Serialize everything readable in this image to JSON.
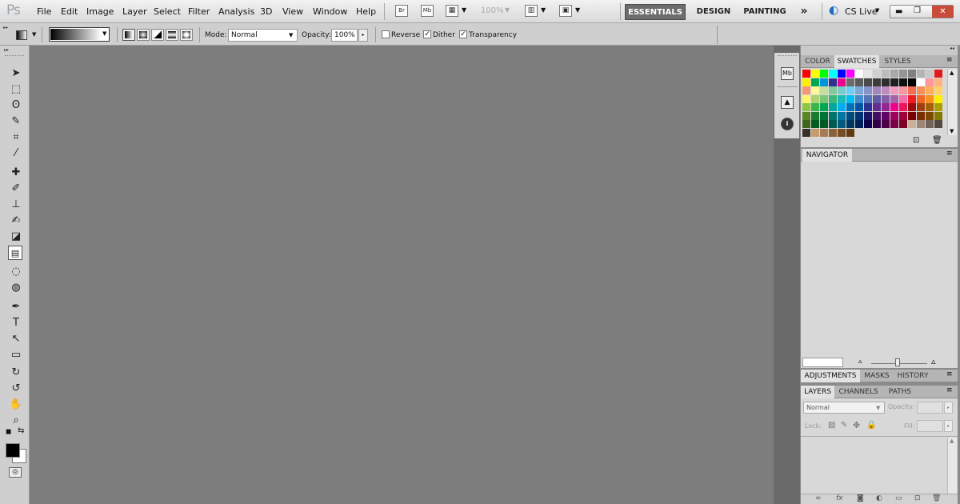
{
  "app": {
    "logo": "Ps"
  },
  "menubar": {
    "items": [
      "File",
      "Edit",
      "Image",
      "Layer",
      "Select",
      "Filter",
      "Analysis",
      "3D",
      "View",
      "Window",
      "Help"
    ],
    "bridge_icon": "Br",
    "minibridge_icon": "Mb",
    "zoom": "100%",
    "workspaces": {
      "essentials": "ESSENTIALS",
      "design": "DESIGN",
      "painting": "PAINTING",
      "more": "»"
    },
    "cslive": "CS Live"
  },
  "options": {
    "mode_label": "Mode:",
    "mode_value": "Normal",
    "opacity_label": "Opacity:",
    "opacity_value": "100%",
    "reverse_label": "Reverse",
    "dither_label": "Dither",
    "transparency_label": "Transparency",
    "check_mark": "✓"
  },
  "tools": [
    {
      "name": "move-tool-icon",
      "glyph": "➤"
    },
    {
      "name": "marquee-tool-icon",
      "glyph": "⬚"
    },
    {
      "name": "lasso-tool-icon",
      "glyph": "ʘ"
    },
    {
      "name": "quick-select-tool-icon",
      "glyph": "✎"
    },
    {
      "name": "crop-tool-icon",
      "glyph": "⌗"
    },
    {
      "name": "eyedropper-tool-icon",
      "glyph": "⁄"
    },
    {
      "name": "healing-brush-tool-icon",
      "glyph": "✚"
    },
    {
      "name": "brush-tool-icon",
      "glyph": "✐"
    },
    {
      "name": "clone-stamp-tool-icon",
      "glyph": "⊥"
    },
    {
      "name": "history-brush-tool-icon",
      "glyph": "✍"
    },
    {
      "name": "eraser-tool-icon",
      "glyph": "◪"
    },
    {
      "name": "gradient-tool-icon",
      "glyph": "▤"
    },
    {
      "name": "blur-tool-icon",
      "glyph": "◌"
    },
    {
      "name": "dodge-tool-icon",
      "glyph": "◍"
    },
    {
      "name": "pen-tool-icon",
      "glyph": "✒"
    },
    {
      "name": "type-tool-icon",
      "glyph": "T"
    },
    {
      "name": "path-selection-tool-icon",
      "glyph": "↖"
    },
    {
      "name": "shape-tool-icon",
      "glyph": "▭"
    },
    {
      "name": "3d-rotate-tool-icon",
      "glyph": "↻"
    },
    {
      "name": "3d-orbit-tool-icon",
      "glyph": "↺"
    },
    {
      "name": "hand-tool-icon",
      "glyph": "✋"
    },
    {
      "name": "zoom-tool-icon",
      "glyph": "⌕"
    }
  ],
  "colors": {
    "foreground": "#000000",
    "background": "#ffffff"
  },
  "panels": {
    "color_tab": "COLOR",
    "swatches_tab": "SWATCHES",
    "styles_tab": "STYLES",
    "navigator_tab": "NAVIGATOR",
    "adjustments_tab": "ADJUSTMENTS",
    "masks_tab": "MASKS",
    "history_tab": "HISTORY",
    "layers_tab": "LAYERS",
    "channels_tab": "CHANNELS",
    "paths_tab": "PATHS",
    "layers_mode": "Normal",
    "opacity_label": "Opacity:",
    "lock_label": "Lock:",
    "fill_label": "Fill:"
  },
  "swatches": [
    [
      "#ff0000",
      "#ffff00",
      "#00ff00",
      "#00ffff",
      "#0000ff",
      "#ff00ff",
      "#ffffff",
      "#e6e6e6",
      "#d0d0d0",
      "#bcbcbc",
      "#a8a8a8",
      "#949494",
      "#808080",
      "#b4b4b4",
      "#c8c8c8",
      "#e01919"
    ],
    [
      "#ffee00",
      "#00a651",
      "#0093dd",
      "#2e3192",
      "#ec008c",
      "#6b6b6b",
      "#5a5a5a",
      "#4a4a4a",
      "#3c3c3c",
      "#2e2e2e",
      "#1f1f1f",
      "#111111",
      "#000000",
      "#ffffff",
      "#ff9999",
      "#ffb380"
    ],
    [
      "#f7977a",
      "#fff79a",
      "#c4df9b",
      "#82ca9c",
      "#7accc8",
      "#6dcff6",
      "#7ea7d8",
      "#8493ca",
      "#a187be",
      "#bc8dbf",
      "#f49ac1",
      "#f6989d",
      "#f26c4f",
      "#f68e55",
      "#fbaf5c",
      "#ffd26e"
    ],
    [
      "#fff568",
      "#acd372",
      "#7cc576",
      "#3bb878",
      "#1abbb4",
      "#00bff3",
      "#438ccb",
      "#5574b9",
      "#605ca8",
      "#855fa8",
      "#a763a8",
      "#f06ea9",
      "#ed1c24",
      "#f26522",
      "#f7941d",
      "#fff200"
    ],
    [
      "#8dc63f",
      "#39b54a",
      "#00a651",
      "#00a99d",
      "#00aeef",
      "#0072bc",
      "#0054a6",
      "#2e3192",
      "#662d91",
      "#92278f",
      "#ec008c",
      "#ed145b",
      "#9e0b0f",
      "#a0410d",
      "#a36209",
      "#aba000"
    ],
    [
      "#598527",
      "#197b30",
      "#007236",
      "#00746b",
      "#0076a3",
      "#004b80",
      "#003471",
      "#1b1464",
      "#440e62",
      "#630460",
      "#9e005d",
      "#9e0039",
      "#790000",
      "#7b2e00",
      "#7d4900",
      "#827b00"
    ],
    [
      "#406618",
      "#005e20",
      "#005826",
      "#005952",
      "#005b7f",
      "#003663",
      "#002157",
      "#0d004c",
      "#32004b",
      "#4b0049",
      "#7b0046",
      "#7a0026",
      "#c7b299",
      "#998675",
      "#736357",
      "#534741"
    ],
    [
      "#37302a",
      "#c69c6d",
      "#a67c52",
      "#8c6239",
      "#754c24",
      "#603913"
    ]
  ]
}
